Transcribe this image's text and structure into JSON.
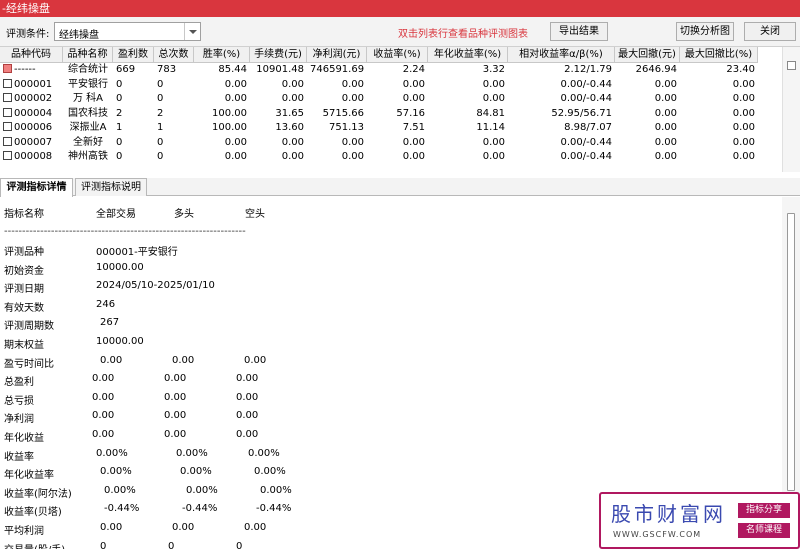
{
  "window": {
    "title": "-经纬操盘"
  },
  "toolbar": {
    "condition_label": "评测条件:",
    "condition_value": "经纬操盘",
    "hint": "双击列表行查看品种评测图表",
    "export_label": "导出结果",
    "switch_label": "切换分析图",
    "close_label": "关闭"
  },
  "grid": {
    "columns": [
      "品种代码",
      "品种名称",
      "盈利数",
      "总次数",
      "胜率(%)",
      "手续费(元)",
      "净利润(元)",
      "收益率(%)",
      "年化收益率(%)",
      "相对收益率α/β(%)",
      "最大回撤(元)",
      "最大回撤比(%)"
    ],
    "rows": [
      [
        "------",
        "综合统计",
        "669",
        "783",
        "85.44",
        "10901.48",
        "746591.69",
        "2.24",
        "3.32",
        "2.12/1.79",
        "2646.94",
        "23.40"
      ],
      [
        "000001",
        "平安银行",
        "0",
        "0",
        "0.00",
        "0.00",
        "0.00",
        "0.00",
        "0.00",
        "0.00/-0.44",
        "0.00",
        "0.00"
      ],
      [
        "000002",
        "万 科A",
        "0",
        "0",
        "0.00",
        "0.00",
        "0.00",
        "0.00",
        "0.00",
        "0.00/-0.44",
        "0.00",
        "0.00"
      ],
      [
        "000004",
        "国农科技",
        "2",
        "2",
        "100.00",
        "31.65",
        "5715.66",
        "57.16",
        "84.81",
        "52.95/56.71",
        "0.00",
        "0.00"
      ],
      [
        "000006",
        "深振业A",
        "1",
        "1",
        "100.00",
        "13.60",
        "751.13",
        "7.51",
        "11.14",
        "8.98/7.07",
        "0.00",
        "0.00"
      ],
      [
        "000007",
        "全新好",
        "0",
        "0",
        "0.00",
        "0.00",
        "0.00",
        "0.00",
        "0.00",
        "0.00/-0.44",
        "0.00",
        "0.00"
      ],
      [
        "000008",
        "神州高铁",
        "0",
        "0",
        "0.00",
        "0.00",
        "0.00",
        "0.00",
        "0.00",
        "0.00/-0.44",
        "0.00",
        "0.00"
      ]
    ]
  },
  "tabs": [
    {
      "label": "评测指标详情"
    },
    {
      "label": "评测指标说明"
    }
  ],
  "detail": {
    "headers": [
      "指标名称",
      "全部交易",
      "多头",
      "空头"
    ],
    "separator": "-------------------------------------------------------------------",
    "info": [
      {
        "label": "评测品种",
        "value": "000001-平安银行"
      },
      {
        "label": "初始资金",
        "value": "10000.00"
      },
      {
        "label": "评测日期",
        "value": "2024/05/10-2025/01/10"
      },
      {
        "label": "有效天数",
        "value": "246"
      },
      {
        "label": "评测周期数",
        "value": "267"
      },
      {
        "label": "期末权益",
        "value": "10000.00"
      }
    ],
    "metrics": [
      {
        "label": "盈亏时间比",
        "all": "0.00",
        "long": "0.00",
        "short": "0.00"
      },
      {
        "label": "总盈利",
        "all": "0.00",
        "long": "0.00",
        "short": "0.00"
      },
      {
        "label": "总亏损",
        "all": "0.00",
        "long": "0.00",
        "short": "0.00"
      },
      {
        "label": "净利润",
        "all": "0.00",
        "long": "0.00",
        "short": "0.00"
      },
      {
        "label": "年化收益",
        "all": "0.00",
        "long": "0.00",
        "short": "0.00"
      },
      {
        "label": "收益率",
        "all": "0.00%",
        "long": "0.00%",
        "short": "0.00%"
      },
      {
        "label": "年化收益率",
        "all": "0.00%",
        "long": "0.00%",
        "short": "0.00%"
      },
      {
        "label": "收益率(阿尔法)",
        "all": "0.00%",
        "long": "0.00%",
        "short": "0.00%"
      },
      {
        "label": "收益率(贝塔)",
        "all": "-0.44%",
        "long": "-0.44%",
        "short": "-0.44%"
      },
      {
        "label": "平均利润",
        "all": "0.00",
        "long": "0.00",
        "short": "0.00"
      },
      {
        "label": "交易量(股/手)",
        "all": "0",
        "long": "0",
        "short": "0"
      }
    ]
  },
  "watermark": {
    "title": "股市财富网",
    "url": "WWW.GSCFW.COM",
    "tag1": "指标分享",
    "tag2": "名师课程"
  },
  "colors": {
    "accent": "#d9363e",
    "brand": "#b01860",
    "logo_blue": "#3a49b0"
  }
}
